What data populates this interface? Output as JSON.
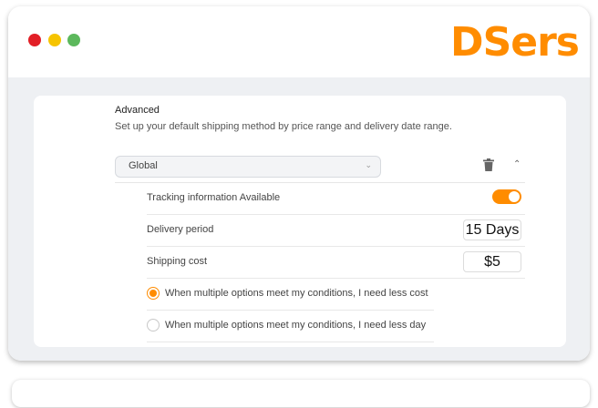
{
  "brand": {
    "logo_text": "DSers",
    "accent_color": "#ff8c00"
  },
  "window_controls": [
    "close-dot",
    "minimize-dot",
    "maximize-dot"
  ],
  "advanced": {
    "title": "Advanced",
    "description": "Set up your default shipping method by price range and delivery date range.",
    "region_select": {
      "value": "Global"
    },
    "tracking": {
      "label": "Tracking information Available",
      "enabled": true
    },
    "delivery": {
      "label": "Delivery period",
      "value": "15 Days"
    },
    "shipping": {
      "label": "Shipping cost",
      "value": "$5"
    },
    "options": [
      {
        "label": "When multiple options meet my conditions, I need less cost",
        "checked": true
      },
      {
        "label": "When multiple options meet my conditions, I need less day",
        "checked": false
      }
    ]
  }
}
